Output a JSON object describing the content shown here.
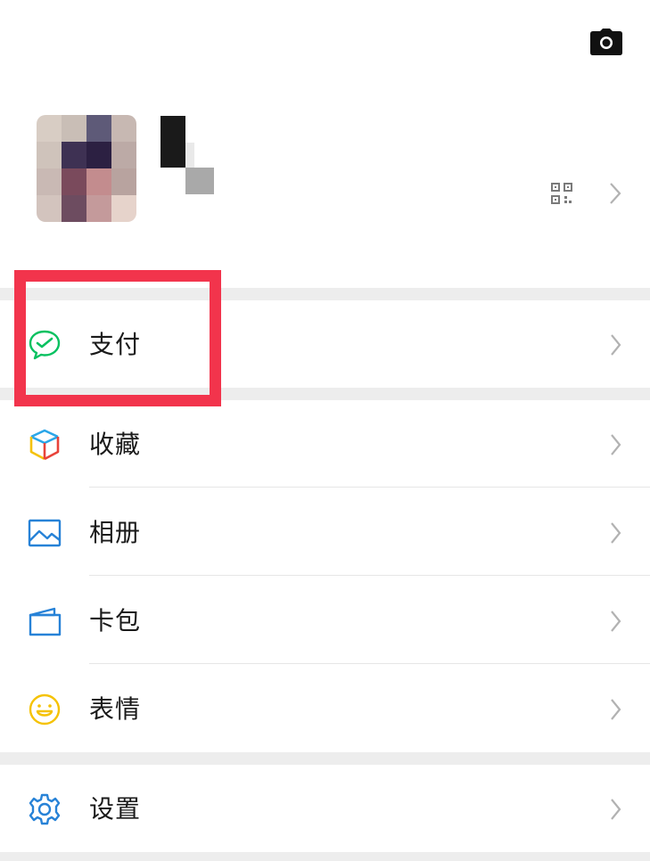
{
  "header": {
    "camera_icon": "camera-icon"
  },
  "profile": {
    "avatar_icon": "avatar",
    "qr_icon": "qr-code-icon",
    "arrow_icon": "chevron-right-icon"
  },
  "menu": {
    "pay": {
      "label": "支付",
      "icon": "wechat-pay-icon",
      "color": "#07c160"
    },
    "favorites": {
      "label": "收藏",
      "icon": "favorites-cube-icon"
    },
    "album": {
      "label": "相册",
      "icon": "album-icon",
      "color": "#2782d7"
    },
    "cards": {
      "label": "卡包",
      "icon": "card-wallet-icon",
      "color": "#2782d7"
    },
    "stickers": {
      "label": "表情",
      "icon": "smiley-icon",
      "color": "#f5c200"
    },
    "settings": {
      "label": "设置",
      "icon": "gear-icon",
      "color": "#2782d7"
    }
  },
  "highlight_color": "#f2344c"
}
